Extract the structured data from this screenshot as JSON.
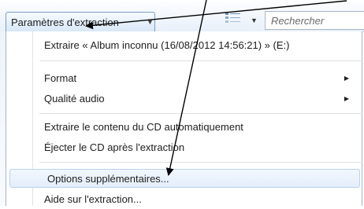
{
  "toolbar": {
    "rip_settings_label": "Paramètres d'extraction",
    "search_placeholder": "Rechercher"
  },
  "menu": {
    "items": [
      {
        "label": "Extraire « Album inconnu (16/08/2012 14:56:21) » (E:)"
      },
      {
        "label": "Format"
      },
      {
        "label": "Qualité audio"
      },
      {
        "label": "Extraire le contenu du CD automatiquement"
      },
      {
        "label": "Éjecter le CD après l'extraction"
      },
      {
        "label": "Options supplémentaires..."
      },
      {
        "label": "Aide sur l'extraction..."
      }
    ],
    "highlighted_index": 5
  },
  "colors": {
    "highlight_border": "#b8d1f2",
    "annotation_arrow": "#000000"
  },
  "icons": [
    "dropdown-icon",
    "view-options-icon",
    "submenu-arrow-icon"
  ]
}
